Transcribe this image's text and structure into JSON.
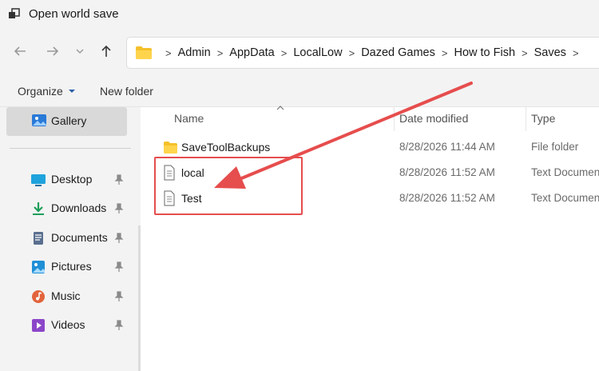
{
  "window": {
    "title": "Open world save",
    "app_icon": "explorer-window-icon"
  },
  "nav": {
    "back_icon": "back-arrow-icon",
    "forward_icon": "forward-arrow-icon",
    "recent_icon": "chevron-down-icon",
    "up_icon": "up-arrow-icon"
  },
  "address": {
    "folder_icon": "folder-icon",
    "crumbs": [
      "Admin",
      "AppData",
      "LocalLow",
      "Dazed Games",
      "How to Fish",
      "Saves"
    ]
  },
  "toolbar": {
    "organize_label": "Organize",
    "new_folder_label": "New folder"
  },
  "sidebar": {
    "gallery_label": "Gallery",
    "items": [
      {
        "label": "Desktop",
        "icon": "desktop-icon",
        "color": "#1fa3dc"
      },
      {
        "label": "Downloads",
        "icon": "download-icon",
        "color": "#1e9e5a"
      },
      {
        "label": "Documents",
        "icon": "documents-icon",
        "color": "#5a6f8f"
      },
      {
        "label": "Pictures",
        "icon": "pictures-icon",
        "color": "#1f8fd6"
      },
      {
        "label": "Music",
        "icon": "music-icon",
        "color": "#e2643c"
      },
      {
        "label": "Videos",
        "icon": "videos-icon",
        "color": "#8b46c9"
      }
    ]
  },
  "columns": {
    "name": "Name",
    "date": "Date modified",
    "type": "Type"
  },
  "files": [
    {
      "name": "SaveToolBackups",
      "date": "8/28/2026 11:44 AM",
      "type": "File folder",
      "icon": "folder-icon"
    },
    {
      "name": "local",
      "date": "8/28/2026 11:52 AM",
      "type": "Text Document",
      "icon": "text-document-icon"
    },
    {
      "name": "Test",
      "date": "8/28/2026 11:52 AM",
      "type": "Text Document",
      "icon": "text-document-icon"
    }
  ],
  "annotation": {
    "color": "#e64d4d"
  }
}
